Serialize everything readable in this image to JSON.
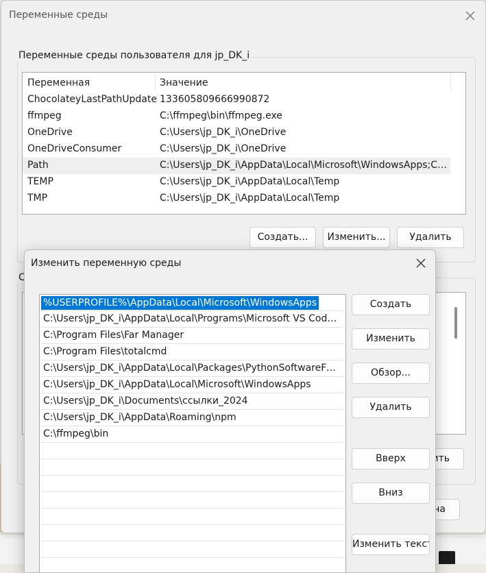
{
  "back_window": {
    "title": "Переменные среды",
    "user_group_label": "Переменные среды пользователя для jp_DK_i",
    "columns": [
      "Переменная",
      "Значение"
    ],
    "rows": [
      {
        "name": "ChocolateyLastPathUpdate",
        "value": "133605809666990872"
      },
      {
        "name": "ffmpeg",
        "value": "C:\\ffmpeg\\bin\\ffmpeg.exe"
      },
      {
        "name": "OneDrive",
        "value": "C:\\Users\\jp_DK_i\\OneDrive"
      },
      {
        "name": "OneDriveConsumer",
        "value": "C:\\Users\\jp_DK_i\\OneDrive"
      },
      {
        "name": "Path",
        "value": "C:\\Users\\jp_DK_i\\AppData\\Local\\Microsoft\\WindowsApps;C:\\..."
      },
      {
        "name": "TEMP",
        "value": "C:\\Users\\jp_DK_i\\AppData\\Local\\Temp"
      },
      {
        "name": "TMP",
        "value": "C:\\Users\\jp_DK_i\\AppData\\Local\\Temp"
      }
    ],
    "selected_row": 4,
    "buttons": {
      "create": "Создать...",
      "edit": "Изменить...",
      "delete": "Удалить"
    },
    "system_group_label_partial": "С",
    "partial_button_1": "ить",
    "partial_button_2": "на"
  },
  "edit_dialog": {
    "title": "Изменить переменную среды",
    "paths": [
      "%USERPROFILE%\\AppData\\Local\\Microsoft\\WindowsApps",
      "C:\\Users\\jp_DK_i\\AppData\\Local\\Programs\\Microsoft VS Code\\...",
      "C:\\Program Files\\Far Manager",
      "C:\\Program Files\\totalcmd",
      "C:\\Users\\jp_DK_i\\AppData\\Local\\Packages\\PythonSoftwareFoun...",
      "C:\\Users\\jp_DK_i\\AppData\\Local\\Microsoft\\WindowsApps",
      "C:\\Users\\jp_DK_i\\Documents\\ссылки_2024",
      "C:\\Users\\jp_DK_i\\AppData\\Roaming\\npm",
      "C:\\ffmpeg\\bin"
    ],
    "selected_index": 0,
    "buttons": {
      "create": "Создать",
      "edit": "Изменить",
      "browse": "Обзор...",
      "delete": "Удалить",
      "up": "Вверх",
      "down": "Вниз",
      "edit_text": "Изменить текст..."
    }
  },
  "colors": {
    "selection": "#0078d7",
    "window_bg": "#f0f0f0"
  },
  "icons": {
    "close": "close-icon"
  }
}
